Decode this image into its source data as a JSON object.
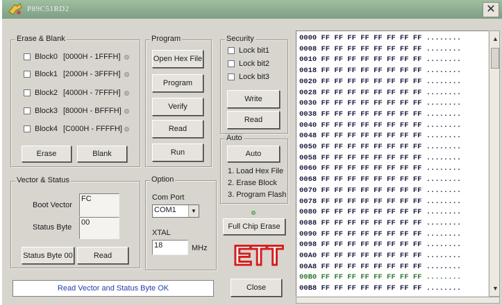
{
  "window": {
    "title": "P89C51RD2",
    "close_glyph": "✕"
  },
  "erase_blank": {
    "label": "Erase & Blank",
    "blocks": [
      {
        "name": "Block0",
        "range": "[0000H - 1FFFH]",
        "checked": false
      },
      {
        "name": "Block1",
        "range": "[2000H - 3FFFH]",
        "checked": false
      },
      {
        "name": "Block2",
        "range": "[4000H - 7FFFH]",
        "checked": false
      },
      {
        "name": "Block3",
        "range": "[8000H - BFFFH]",
        "checked": false
      },
      {
        "name": "Block4",
        "range": "[C000H - FFFFH]",
        "checked": false
      }
    ],
    "erase_label": "Erase",
    "blank_label": "Blank"
  },
  "program": {
    "label": "Program",
    "open_hex_label": "Open Hex File",
    "program_label": "Program",
    "verify_label": "Verify",
    "read_label": "Read",
    "run_label": "Run"
  },
  "security": {
    "label": "Security",
    "lock_bits": [
      {
        "name": "Lock bit1",
        "checked": false
      },
      {
        "name": "Lock bit2",
        "checked": false
      },
      {
        "name": "Lock bit3",
        "checked": false
      }
    ],
    "write_label": "Write",
    "read_label": "Read"
  },
  "auto": {
    "label": "Auto",
    "auto_button": "Auto",
    "steps": [
      "1. Load Hex File",
      "2. Erase Block",
      "3. Program Flash"
    ]
  },
  "vector_status": {
    "label": "Vector & Status",
    "boot_vector_label": "Boot Vector",
    "boot_vector_value": "FC",
    "status_byte_label": "Status Byte",
    "status_byte_value": "00",
    "status_byte_button": "Status Byte 00",
    "read_label": "Read"
  },
  "option": {
    "label": "Option",
    "com_port_label": "Com Port",
    "com_port_value": "COM1",
    "xtal_label": "XTAL",
    "xtal_value": "18",
    "xtal_unit": "MHz"
  },
  "full_chip_erase_label": "Full Chip Erase",
  "logo_text": "ETT",
  "close_label": "Close",
  "status_message": "Read Vector and Status Byte OK",
  "hex_dump": {
    "lines": [
      "0000 FF FF FF FF FF FF FF FF ........",
      "0008 FF FF FF FF FF FF FF FF ........",
      "0010 FF FF FF FF FF FF FF FF ........",
      "0018 FF FF FF FF FF FF FF FF ........",
      "0020 FF FF FF FF FF FF FF FF ........",
      "0028 FF FF FF FF FF FF FF FF ........",
      "0030 FF FF FF FF FF FF FF FF ........",
      "0038 FF FF FF FF FF FF FF FF ........",
      "0040 FF FF FF FF FF FF FF FF ........",
      "0048 FF FF FF FF FF FF FF FF ........",
      "0050 FF FF FF FF FF FF FF FF ........",
      "0058 FF FF FF FF FF FF FF FF ........",
      "0060 FF FF FF FF FF FF FF FF ........",
      "0068 FF FF FF FF FF FF FF FF ........",
      "0070 FF FF FF FF FF FF FF FF ........",
      "0078 FF FF FF FF FF FF FF FF ........",
      "0080 FF FF FF FF FF FF FF FF ........",
      "0088 FF FF FF FF FF FF FF FF ........",
      "0090 FF FF FF FF FF FF FF FF ........",
      "0098 FF FF FF FF FF FF FF FF ........",
      "00A0 FF FF FF FF FF FF FF FF ........",
      "00A8 FF FF FF FF FF FF FF FF ........",
      "00B0 FF FF FF FF FF FF FF FF ........",
      "00B8 FF FF FF FF FF FF FF FF ........"
    ],
    "highlighted_line": 22
  },
  "colors": {
    "title_bar": "#8aab8e",
    "status_text": "#2040b0",
    "logo_red": "#d42020",
    "highlight_line": "#2a7a2a"
  }
}
